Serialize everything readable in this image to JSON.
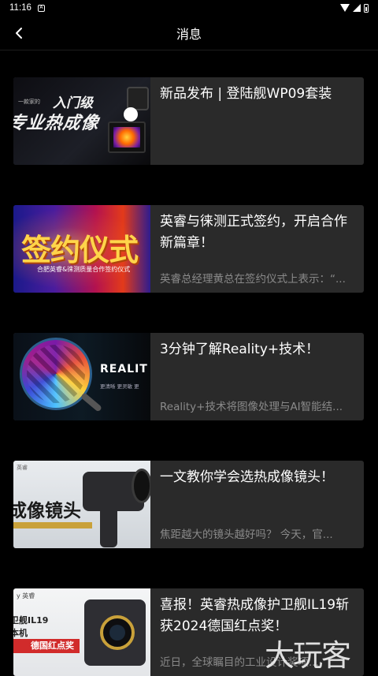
{
  "status_bar": {
    "time": "11:16",
    "notification_glyph": "A",
    "icons": [
      "wifi-icon",
      "signal-icon",
      "battery-icon"
    ]
  },
  "header": {
    "title": "消息",
    "back_icon": "chevron-left-icon"
  },
  "messages": [
    {
      "title": "新品发布 | 登陆舰WP09套装",
      "summary": "",
      "thumb_text": [
        "入门级",
        "专业热成像",
        "一款家的"
      ]
    },
    {
      "title": "英睿与徕测正式签约，开启合作新篇章！",
      "summary": "英睿总经理黄总在签约仪式上表示：“...",
      "thumb_text": [
        "签约仪式",
        "合肥英睿&徕测质量合作签约仪式"
      ]
    },
    {
      "title": "3分钟了解Reality+技术！",
      "summary": "Reality+技术将图像处理与AI智能结...",
      "thumb_text": [
        "REALIT",
        "更清晰 更灵敏 更"
      ]
    },
    {
      "title": "一文教你学会选热成像镜头！",
      "summary": "焦距越大的镜头越好吗？ 今天，官...",
      "thumb_text": [
        "成像镜头",
        "英睿"
      ]
    },
    {
      "title": "喜报！英睿热成像护卫舰IL19斩获2024德国红点奖！",
      "summary": "近日，全球瞩目的工业设计奖项...",
      "thumb_text": [
        "y 英睿",
        "卫舰IL19",
        "本机",
        "德国红点奖"
      ]
    }
  ],
  "watermark": "大玩客"
}
